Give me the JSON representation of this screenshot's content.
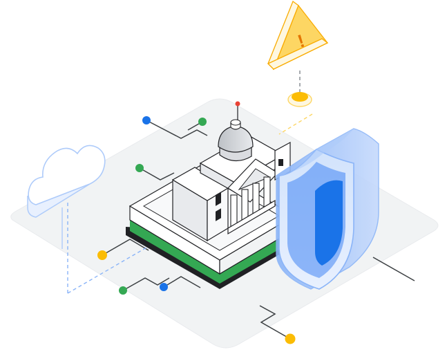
{
  "illustration": {
    "icons": [
      "cloud-icon",
      "government-building-icon",
      "security-shield-icon",
      "warning-triangle-icon",
      "circuit-network-lines"
    ],
    "warning_symbol": "!"
  },
  "colors": {
    "platform": "#f1f3f4",
    "green": "#34a853",
    "blue": "#1a73e8",
    "yellow": "#fbbc04",
    "red": "#ea4335",
    "line": "#3c4043",
    "light_blue": "#aecbfa"
  }
}
